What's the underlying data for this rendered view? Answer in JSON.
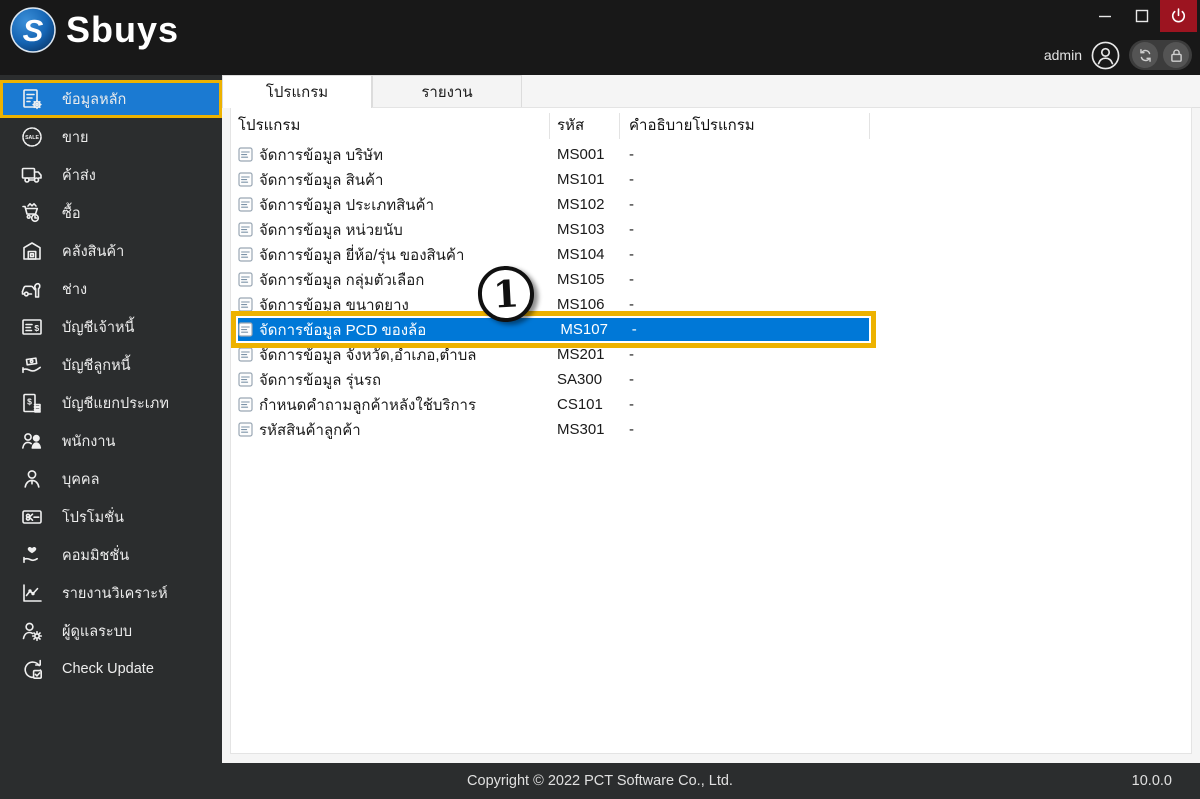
{
  "titlebar": {
    "logo_text": "Sbuys",
    "user_label": "admin"
  },
  "sidebar": {
    "items": [
      {
        "id": "master-data",
        "label": "ข้อมูลหลัก",
        "icon": "master-data",
        "active": true
      },
      {
        "id": "sales",
        "label": "ขาย",
        "icon": "sale-badge",
        "active": false
      },
      {
        "id": "wholesale",
        "label": "ค้าส่ง",
        "icon": "delivery-truck",
        "active": false
      },
      {
        "id": "purchase",
        "label": "ซื้อ",
        "icon": "purchase-cart",
        "active": false
      },
      {
        "id": "warehouse",
        "label": "คลังสินค้า",
        "icon": "warehouse",
        "active": false
      },
      {
        "id": "technician",
        "label": "ช่าง",
        "icon": "car-wrench",
        "active": false
      },
      {
        "id": "accounts-payable",
        "label": "บัญชีเจ้าหนี้",
        "icon": "invoice-dollar",
        "active": false
      },
      {
        "id": "accounts-receivable",
        "label": "บัญชีลูกหนี้",
        "icon": "hand-money",
        "active": false
      },
      {
        "id": "general-ledger",
        "label": "บัญชีแยกประเภท",
        "icon": "ledger-doc",
        "active": false
      },
      {
        "id": "employees",
        "label": "พนักงาน",
        "icon": "employees",
        "active": false
      },
      {
        "id": "person",
        "label": "บุคคล",
        "icon": "person",
        "active": false
      },
      {
        "id": "promotion",
        "label": "โปรโมชั่น",
        "icon": "gift-card",
        "active": false
      },
      {
        "id": "commission",
        "label": "คอมมิชชั่น",
        "icon": "hand-heart",
        "active": false
      },
      {
        "id": "analysis-report",
        "label": "รายงานวิเคราะห์",
        "icon": "chart-line",
        "active": false
      },
      {
        "id": "administrator",
        "label": "ผู้ดูแลระบบ",
        "icon": "admin-gear",
        "active": false
      },
      {
        "id": "check-update",
        "label": "Check Update",
        "icon": "update-check",
        "active": false
      }
    ]
  },
  "tabs": [
    {
      "label": "โปรแกรม",
      "active": true
    },
    {
      "label": "รายงาน",
      "active": false
    }
  ],
  "table": {
    "columns": [
      "โปรแกรม",
      "รหัส",
      "คำอธิบายโปรแกรม"
    ],
    "rows": [
      {
        "name": "จัดการข้อมูล บริษัท",
        "code": "MS001",
        "desc": "-",
        "selected": false
      },
      {
        "name": "จัดการข้อมูล สินค้า",
        "code": "MS101",
        "desc": "-",
        "selected": false
      },
      {
        "name": "จัดการข้อมูล ประเภทสินค้า",
        "code": "MS102",
        "desc": "-",
        "selected": false
      },
      {
        "name": "จัดการข้อมูล หน่วยนับ",
        "code": "MS103",
        "desc": "-",
        "selected": false
      },
      {
        "name": "จัดการข้อมูล ยี่ห้อ/รุ่น ของสินค้า",
        "code": "MS104",
        "desc": "-",
        "selected": false
      },
      {
        "name": "จัดการข้อมูล กลุ่มตัวเลือก",
        "code": "MS105",
        "desc": "-",
        "selected": false
      },
      {
        "name": "จัดการข้อมูล ขนาดยาง",
        "code": "MS106",
        "desc": "-",
        "selected": false
      },
      {
        "name": "จัดการข้อมูล PCD ของล้อ",
        "code": "MS107",
        "desc": "-",
        "selected": true
      },
      {
        "name": "จัดการข้อมูล จังหวัด,อำเภอ,ตำบล",
        "code": "MS201",
        "desc": "-",
        "selected": false
      },
      {
        "name": "จัดการข้อมูล รุ่นรถ",
        "code": "SA300",
        "desc": "-",
        "selected": false
      },
      {
        "name": "กำหนดคำถามลูกค้าหลังใช้บริการ",
        "code": "CS101",
        "desc": "-",
        "selected": false
      },
      {
        "name": "รหัสสินค้าลูกค้า",
        "code": "MS301",
        "desc": "-",
        "selected": false
      }
    ]
  },
  "annotation": {
    "label": "1"
  },
  "footer": {
    "copyright": "Copyright © 2022 PCT Software Co., Ltd.",
    "version": "10.0.0"
  },
  "colors": {
    "titlebar_bg": "#181818",
    "sidebar_bg": "#2b2d2e",
    "sidebar_active_blue": "#1b7ad2",
    "selection_blue": "#0078d7",
    "highlight_yellow": "#edb200",
    "power_red": "#9c1420",
    "content_bg": "#f5f5f5"
  }
}
